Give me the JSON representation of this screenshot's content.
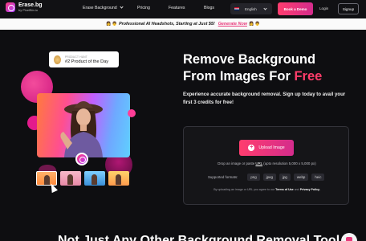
{
  "nav": {
    "logo_name": "Erase.bg",
    "logo_by": "by PixelBin.io",
    "links": [
      "Erase Background",
      "Pricing",
      "Features",
      "Blogs"
    ],
    "language": "English",
    "book_demo": "Book a Demo",
    "login": "Login",
    "signup": "Signup"
  },
  "banner": {
    "emoji_left": "👩 👨",
    "text": "Professional AI Headshots, Starting at Just $5!",
    "cta": "Generate Now",
    "emoji_right": "👩 👨"
  },
  "showcase": {
    "badge_top": "PRODUCT HUNT",
    "badge_main": "#2 Product of the Day"
  },
  "hero": {
    "title_line1": "Remove Background",
    "title_line2_prefix": "From Images For",
    "title_line2_accent": "Free",
    "subtitle": "Experience accurate background removal. Sign up today to avail your first 3 credits for free!"
  },
  "upload": {
    "button": "Upload Image",
    "drop_prefix": "Drop an image or paste",
    "drop_url": "URL",
    "drop_suffix": "(upto resolution 5,000 x 5,000 px)",
    "formats_label": "Supported formats:",
    "formats": [
      "png",
      "jpeg",
      "jpg",
      "webp",
      "heic"
    ],
    "terms_prefix": "By uploading an image or URL you agree to our",
    "terms_link": "Terms of Use",
    "terms_and": "and",
    "privacy_link": "Privacy Policy."
  },
  "section": {
    "title": "Not Just Any Other Background Removal Tool"
  },
  "colors": {
    "accent": "#ff3d6a",
    "background": "#0e0e11",
    "banner": "#fafafa"
  }
}
